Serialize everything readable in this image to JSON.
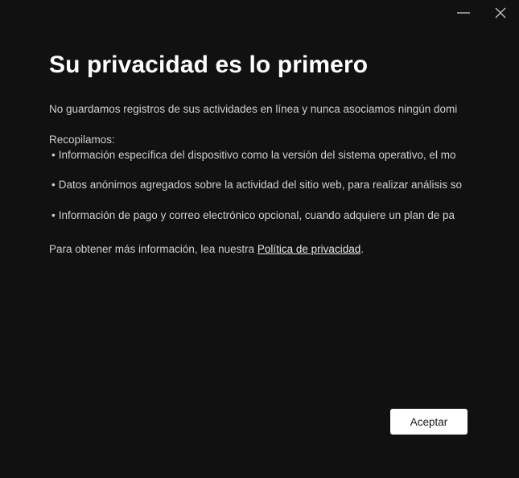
{
  "window": {
    "controls": [
      {
        "name": "minimize",
        "icon": "minimize-icon"
      },
      {
        "name": "close",
        "icon": "close-icon"
      }
    ]
  },
  "privacy": {
    "title": "Su privacidad es lo primero",
    "intro": "No guardamos registros de sus actividades en línea y nunca asociamos ningún domi",
    "collect_heading": "Recopilamos:",
    "bullets": [
      "Información específica del dispositivo como la versión del sistema operativo, el mo",
      "Datos anónimos agregados sobre la actividad del sitio web, para realizar análisis so",
      "Información de pago y correo electrónico opcional, cuando adquiere un plan de pa"
    ],
    "bullet_marker": "•",
    "more_info_prefix": "Para obtener más información, lea nuestra ",
    "policy_link": "Política de privacidad",
    "more_info_suffix": "."
  },
  "actions": {
    "accept_label": "Aceptar"
  },
  "colors": {
    "background": "#111112",
    "text": "#cfcfcf",
    "title": "#ffffff",
    "button_bg": "#ffffff",
    "button_text": "#1a1a1a"
  }
}
